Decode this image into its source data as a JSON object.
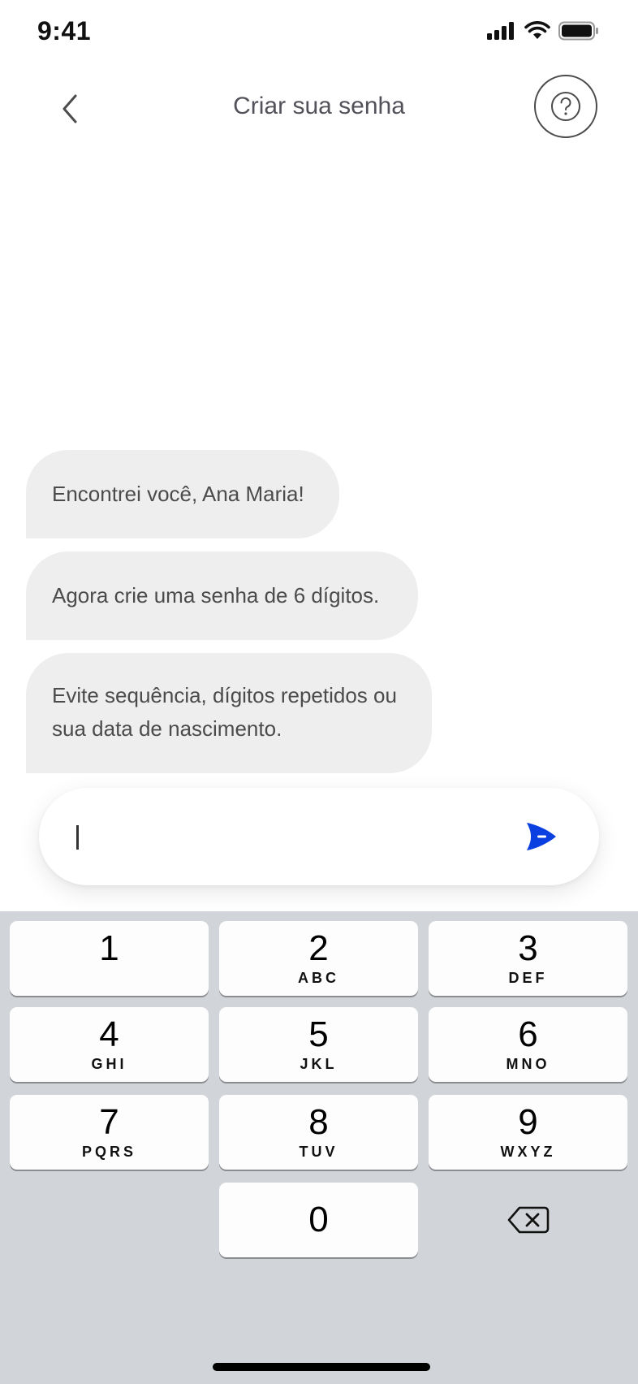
{
  "status_bar": {
    "time": "9:41",
    "icons": [
      "signal-icon",
      "wifi-icon",
      "battery-icon"
    ]
  },
  "header": {
    "title": "Criar sua senha",
    "back_icon": "chevron-left-icon",
    "help_icon": "question-icon"
  },
  "chat": {
    "messages": [
      "Encontrei você, Ana Maria!",
      "Agora crie uma senha de 6 dígitos.",
      "Evite sequência, dígitos repetidos ou sua data de nascimento."
    ]
  },
  "input": {
    "value": "",
    "send_icon": "send-icon",
    "accent_color": "#0a3fe0"
  },
  "keyboard": {
    "keys": [
      {
        "digit": "1",
        "letters": ""
      },
      {
        "digit": "2",
        "letters": "ABC"
      },
      {
        "digit": "3",
        "letters": "DEF"
      },
      {
        "digit": "4",
        "letters": "GHI"
      },
      {
        "digit": "5",
        "letters": "JKL"
      },
      {
        "digit": "6",
        "letters": "MNO"
      },
      {
        "digit": "7",
        "letters": "PQRS"
      },
      {
        "digit": "8",
        "letters": "TUV"
      },
      {
        "digit": "9",
        "letters": "WXYZ"
      },
      {
        "digit": "0",
        "letters": ""
      }
    ],
    "delete_icon": "backspace-icon"
  }
}
